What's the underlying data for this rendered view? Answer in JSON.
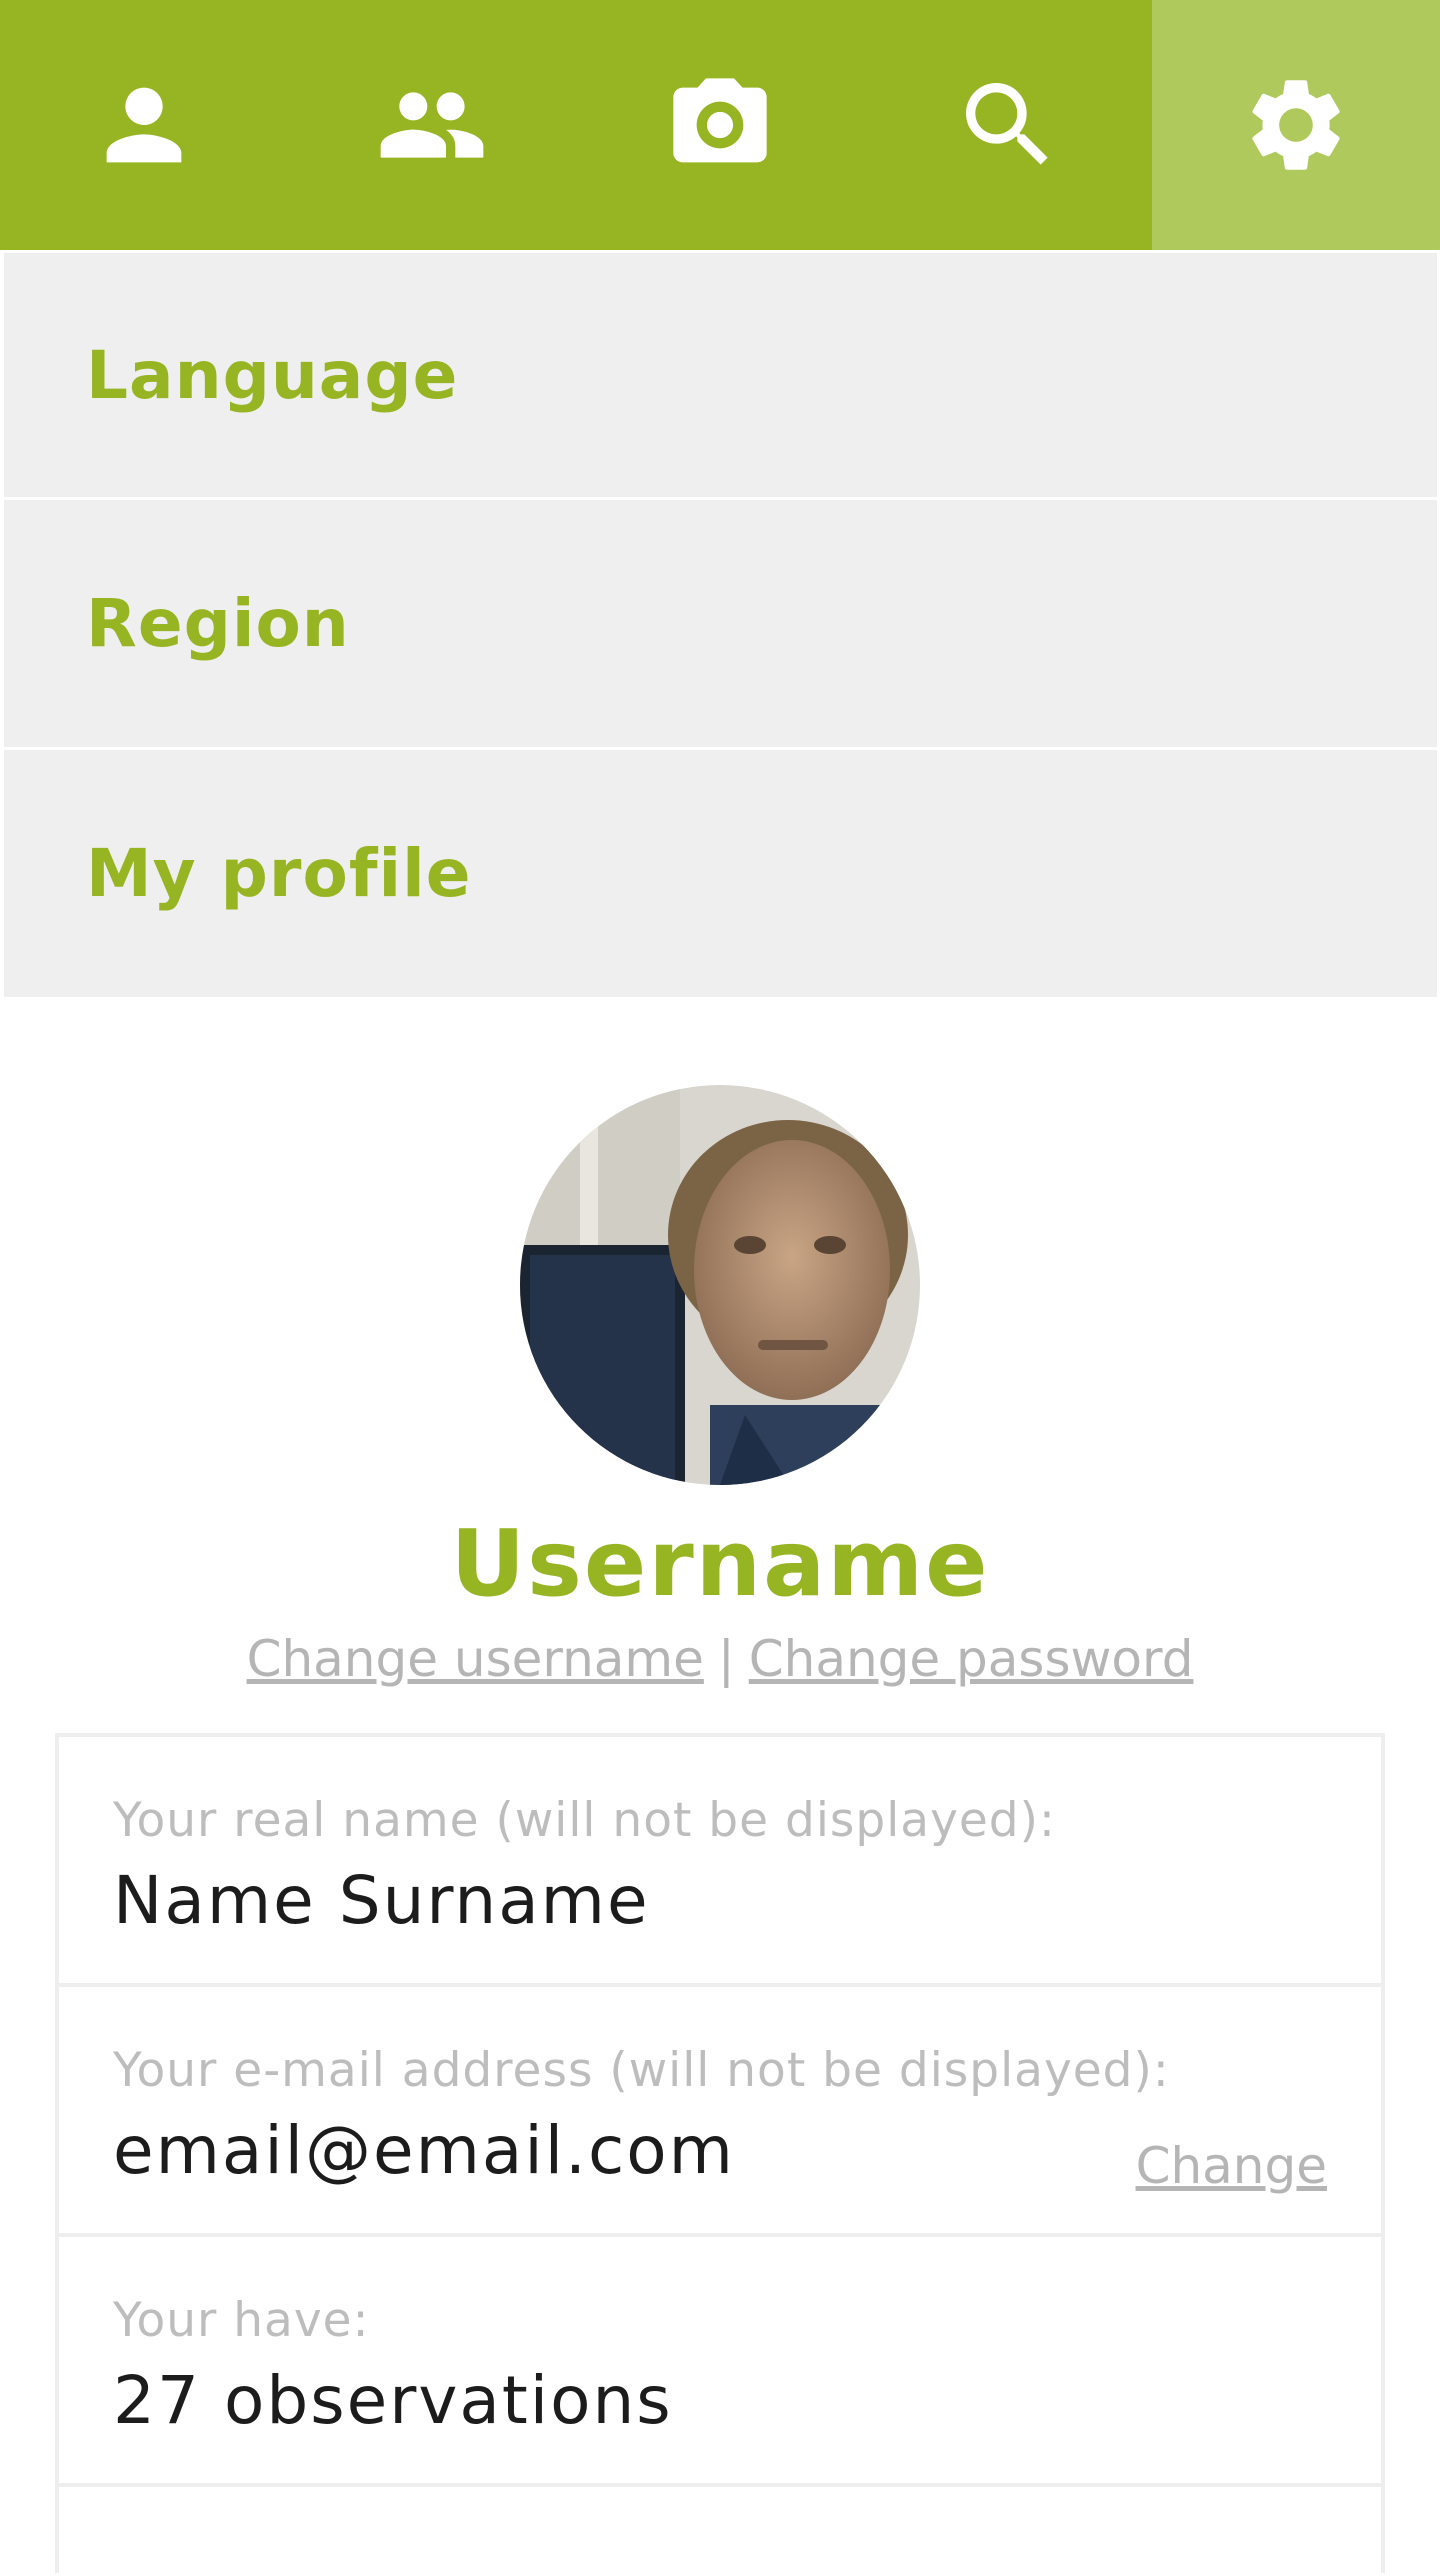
{
  "tabs": [
    {
      "icon": "person-icon",
      "active": false
    },
    {
      "icon": "people-icon",
      "active": false
    },
    {
      "icon": "camera-icon",
      "active": false
    },
    {
      "icon": "search-icon",
      "active": false
    },
    {
      "icon": "gear-icon",
      "active": true
    }
  ],
  "menu": {
    "items": [
      {
        "label": "Language"
      },
      {
        "label": "Region"
      },
      {
        "label": "My profile"
      }
    ]
  },
  "profile": {
    "username": "Username",
    "change_username": "Change username",
    "separator": "|",
    "change_password": "Change password",
    "fields": {
      "real_name": {
        "label": "Your real name (will not be displayed):",
        "value": "Name Surname"
      },
      "email": {
        "label": "Your e-mail address (will not be displayed):",
        "value": "email@email.com",
        "change_label": "Change"
      },
      "observations": {
        "label": "Your have:",
        "value": "27 observations"
      }
    }
  },
  "colors": {
    "brand_green": "#97b523",
    "active_tab": "#b0c95c",
    "menu_bg": "#efefef"
  }
}
